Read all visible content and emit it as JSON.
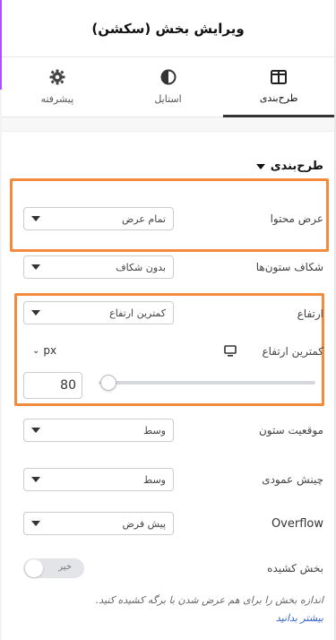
{
  "header": {
    "title": "ویرایش بخش (سکشن)"
  },
  "tabs": [
    {
      "label": "طرح‌بندی",
      "icon": "layout-columns-icon",
      "active": true
    },
    {
      "label": "استایل",
      "icon": "contrast-icon",
      "active": false
    },
    {
      "label": "پیشرفته",
      "icon": "gear-icon",
      "active": false
    }
  ],
  "section": {
    "title": "طرح‌بندی"
  },
  "content_width": {
    "label": "عرض محتوا",
    "value": "تمام عرض"
  },
  "columns_gap": {
    "label": "شکاف ستون‌ها",
    "value": "بدون شکاف"
  },
  "height": {
    "label": "ارتفاع",
    "value": "کمترین ارتفاع"
  },
  "min_height": {
    "label": "کمترین ارتفاع",
    "unit": "px",
    "value": "80",
    "level": 0
  },
  "column_position": {
    "label": "موقعیت ستون",
    "value": "وسط"
  },
  "vertical_align": {
    "label": "چینش عمودی",
    "value": "وسط"
  },
  "overflow": {
    "label": "Overflow",
    "value": "پیش فرض"
  },
  "stretch": {
    "label": "بخش کشیده",
    "toggle_text": "خیر",
    "on": false
  },
  "help": {
    "text": "اندازه بخش را برای هم عرض شدن با برگه کشیده کنید.",
    "link": "بیشتر بدانید"
  },
  "colors": {
    "highlight": "#f28c3c",
    "link": "#2f5fd0",
    "accent_edge": "#a855f7"
  }
}
